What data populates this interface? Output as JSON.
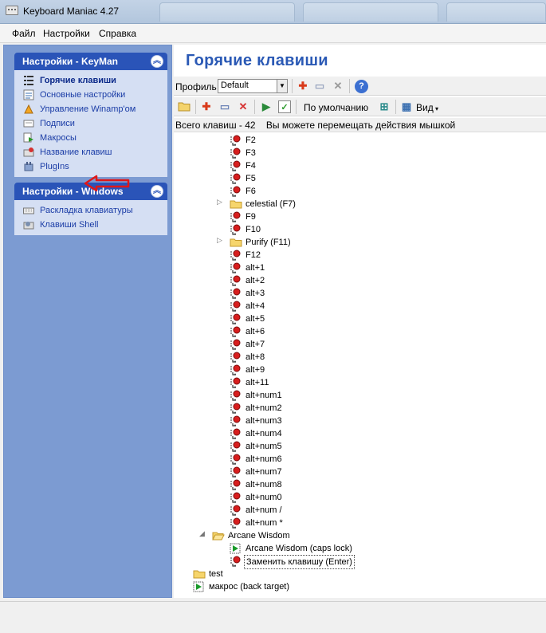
{
  "window": {
    "title": "Keyboard Maniac 4.27"
  },
  "menubar": [
    "Файл",
    "Настройки",
    "Справка"
  ],
  "left": {
    "panel1": {
      "title": "Настройки - KeyMan",
      "items": [
        {
          "label": "Горячие клавиши",
          "icon": "list-icon",
          "active": true
        },
        {
          "label": "Основные настройки",
          "icon": "settings-list-icon"
        },
        {
          "label": "Управление Winamp'ом",
          "icon": "winamp-icon"
        },
        {
          "label": "Подписи",
          "icon": "caption-icon"
        },
        {
          "label": "Макросы",
          "icon": "macro-icon"
        },
        {
          "label": "Название клавиш",
          "icon": "key-names-icon"
        },
        {
          "label": "PlugIns",
          "icon": "plugin-icon"
        }
      ]
    },
    "panel2": {
      "title": "Настройки - Windows",
      "items": [
        {
          "label": "Раскладка клавиатуры",
          "icon": "keyboard-icon"
        },
        {
          "label": "Клавиши Shell",
          "icon": "shell-icon"
        }
      ]
    }
  },
  "main": {
    "title": "Горячие клавиши",
    "toolbar1": {
      "profile_label": "Профиль",
      "profile_value": "Default"
    },
    "toolbar2": {
      "default_label": "По умолчанию",
      "view_label": "Вид"
    },
    "status": {
      "total": "Всего клавиш - 42",
      "hint": "Вы можете перемещать действия мышкой"
    },
    "tree": [
      {
        "label": "F2",
        "icon": "hotkey",
        "indent": 2
      },
      {
        "label": "F3",
        "icon": "hotkey",
        "indent": 2
      },
      {
        "label": "F4",
        "icon": "hotkey",
        "indent": 2
      },
      {
        "label": "F5",
        "icon": "hotkey",
        "indent": 2
      },
      {
        "label": "F6",
        "icon": "hotkey",
        "indent": 2
      },
      {
        "label": "celestial (F7)",
        "icon": "folder",
        "indent": 2,
        "expander": "▷"
      },
      {
        "label": "F9",
        "icon": "hotkey",
        "indent": 2
      },
      {
        "label": "F10",
        "icon": "hotkey",
        "indent": 2
      },
      {
        "label": "Purify (F11)",
        "icon": "folder",
        "indent": 2,
        "expander": "▷"
      },
      {
        "label": "F12",
        "icon": "hotkey",
        "indent": 2
      },
      {
        "label": "alt+1",
        "icon": "hotkey",
        "indent": 2
      },
      {
        "label": "alt+2",
        "icon": "hotkey",
        "indent": 2
      },
      {
        "label": "alt+3",
        "icon": "hotkey",
        "indent": 2
      },
      {
        "label": "alt+4",
        "icon": "hotkey",
        "indent": 2
      },
      {
        "label": "alt+5",
        "icon": "hotkey",
        "indent": 2
      },
      {
        "label": "alt+6",
        "icon": "hotkey",
        "indent": 2
      },
      {
        "label": "alt+7",
        "icon": "hotkey",
        "indent": 2
      },
      {
        "label": "alt+8",
        "icon": "hotkey",
        "indent": 2
      },
      {
        "label": "alt+9",
        "icon": "hotkey",
        "indent": 2
      },
      {
        "label": "alt+11",
        "icon": "hotkey",
        "indent": 2
      },
      {
        "label": "alt+num1",
        "icon": "hotkey",
        "indent": 2
      },
      {
        "label": "alt+num2",
        "icon": "hotkey",
        "indent": 2
      },
      {
        "label": "alt+num3",
        "icon": "hotkey",
        "indent": 2
      },
      {
        "label": "alt+num4",
        "icon": "hotkey",
        "indent": 2
      },
      {
        "label": "alt+num5",
        "icon": "hotkey",
        "indent": 2
      },
      {
        "label": "alt+num6",
        "icon": "hotkey",
        "indent": 2
      },
      {
        "label": "alt+num7",
        "icon": "hotkey",
        "indent": 2
      },
      {
        "label": "alt+num8",
        "icon": "hotkey",
        "indent": 2
      },
      {
        "label": "alt+num0",
        "icon": "hotkey",
        "indent": 2
      },
      {
        "label": "alt+num /",
        "icon": "hotkey",
        "indent": 2
      },
      {
        "label": "alt+num *",
        "icon": "hotkey",
        "indent": 2
      },
      {
        "label": "Arcane Wisdom",
        "icon": "folder-open",
        "indent": 1,
        "expander": "◢"
      },
      {
        "label": "Arcane Wisdom (caps lock)",
        "icon": "macro",
        "indent": 2
      },
      {
        "label": "Заменить клавишу (Enter)",
        "icon": "hotkey",
        "indent": 2,
        "selected": true
      },
      {
        "label": "test",
        "icon": "folder",
        "indent": 0
      },
      {
        "label": "макрос (back target)",
        "icon": "macro",
        "indent": 0
      }
    ]
  },
  "colors": {
    "panel_header": "#2a54b8",
    "panel_body": "#d5dff3",
    "left_bg": "#7c9bd2",
    "title": "#2a59b5"
  }
}
